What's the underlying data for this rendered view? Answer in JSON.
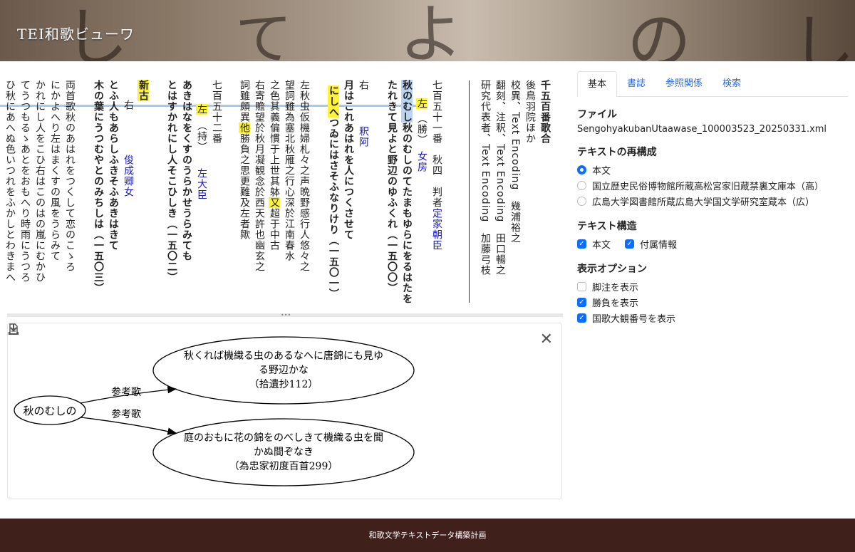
{
  "app": {
    "title": "TEI和歌ビューワ"
  },
  "columns": {
    "c1": "千五百番歌合",
    "c2": "後鳥羽院ほか",
    "c3": "校異、Text Encoding　幾浦裕之",
    "c4": "翻刻、注釈、Text Encoding　田口暢之",
    "c5": "研究代表者、Text Encoding　加藤弓枝",
    "c6a": "七百五十一番　秋四　判者",
    "c6b": "定家朝臣",
    "c7a": "左",
    "c7b": "（勝）",
    "c7c": "女房",
    "c8a": "秋のむしのてたまもゆらにをるはたを",
    "c8b": "たれきて見よと野辺のゆふくれ（一五〇〇）",
    "c9a": "右",
    "c9b": "釈阿",
    "c10": "月はこれあはれを人につくさせて",
    "c11a": "にしへ",
    "c11b": "つゐにはさそふなりけり（一五〇一）",
    "c12": "左秋虫仮機婦札々之声晩野感行人悠々之",
    "c13": "望詞雖為塞北秋雁之行心深於江南春水",
    "c14a": "之色其義偏慣于上世其躰",
    "c14b": "又",
    "c14c": "超于中古",
    "c15": "右寄贍望於秋月凝観念於西天許也幽玄之",
    "c16a": "詞雖頗異",
    "c16b": "他",
    "c16c": "勝負之思更難及左者歟",
    "c17": "七百五十二番",
    "c18a": "左",
    "c18b": "（持）",
    "c18c": "左大臣",
    "c19": "あきはなをくすのうらかせうらみても",
    "c20": "とはすかれにし人そこひしき（一五〇二）",
    "c21a": "右",
    "c21b": "俊成卿女",
    "c22a": "新古",
    "c22b": "とふ人もあらしふきそふあきはきて",
    "c23": "木の葉にうつむやとのみちしは（一五〇三）",
    "c24": "両首歌秋のあはれをつくして恋のこゝろ",
    "c25": "にかよへり左はまくすの風をうらみて",
    "c26": "かれにし人をこひ右はこのはの嵐にむかひ",
    "c27": "てうつもるゝあとをおもへり時雨にうつろ",
    "c28": "ひ秋にあへぬ色いつれをふかしとわきまへ"
  },
  "graph": {
    "source_node": "秋のむしの",
    "edge1_label": "参考歌",
    "edge2_label": "参考歌",
    "target1_line1": "秋くれば機織る虫のあるなへに唐錦にも見ゆ",
    "target1_line2": "る野辺かな",
    "target1_line3": "（拾遺抄112）",
    "target2_line1": "庭のおもに花の錦をのべしきて機織る虫を聞",
    "target2_line2": "かぬ間ぞなき",
    "target2_line3": "（為忠家初度百首299）"
  },
  "tabs": [
    "基本",
    "書誌",
    "参照関係",
    "検索"
  ],
  "panel": {
    "file_title": "ファイル",
    "file_name": "SengohyakubanUtaawase_100003523_20250331.xml",
    "recon_title": "テキストの再構成",
    "recon_opts": [
      "本文",
      "国立歴史民俗博物館所蔵高松宮家旧蔵禁裏文庫本（高）",
      "広島大学図書館所蔵広島大学国文学研究室蔵本（広）"
    ],
    "struct_title": "テキスト構造",
    "struct_opts": [
      "本文",
      "付属情報"
    ],
    "display_title": "表示オプション",
    "display_opts": [
      "脚注を表示",
      "勝負を表示",
      "国歌大観番号を表示"
    ]
  },
  "footer": {
    "text": "和歌文学テキストデータ構築計画"
  },
  "colors": {
    "highlight": "#fff33a",
    "link_blue": "#2d6cdf",
    "footer_bg": "#40201a",
    "accent": "#0d6efd"
  }
}
